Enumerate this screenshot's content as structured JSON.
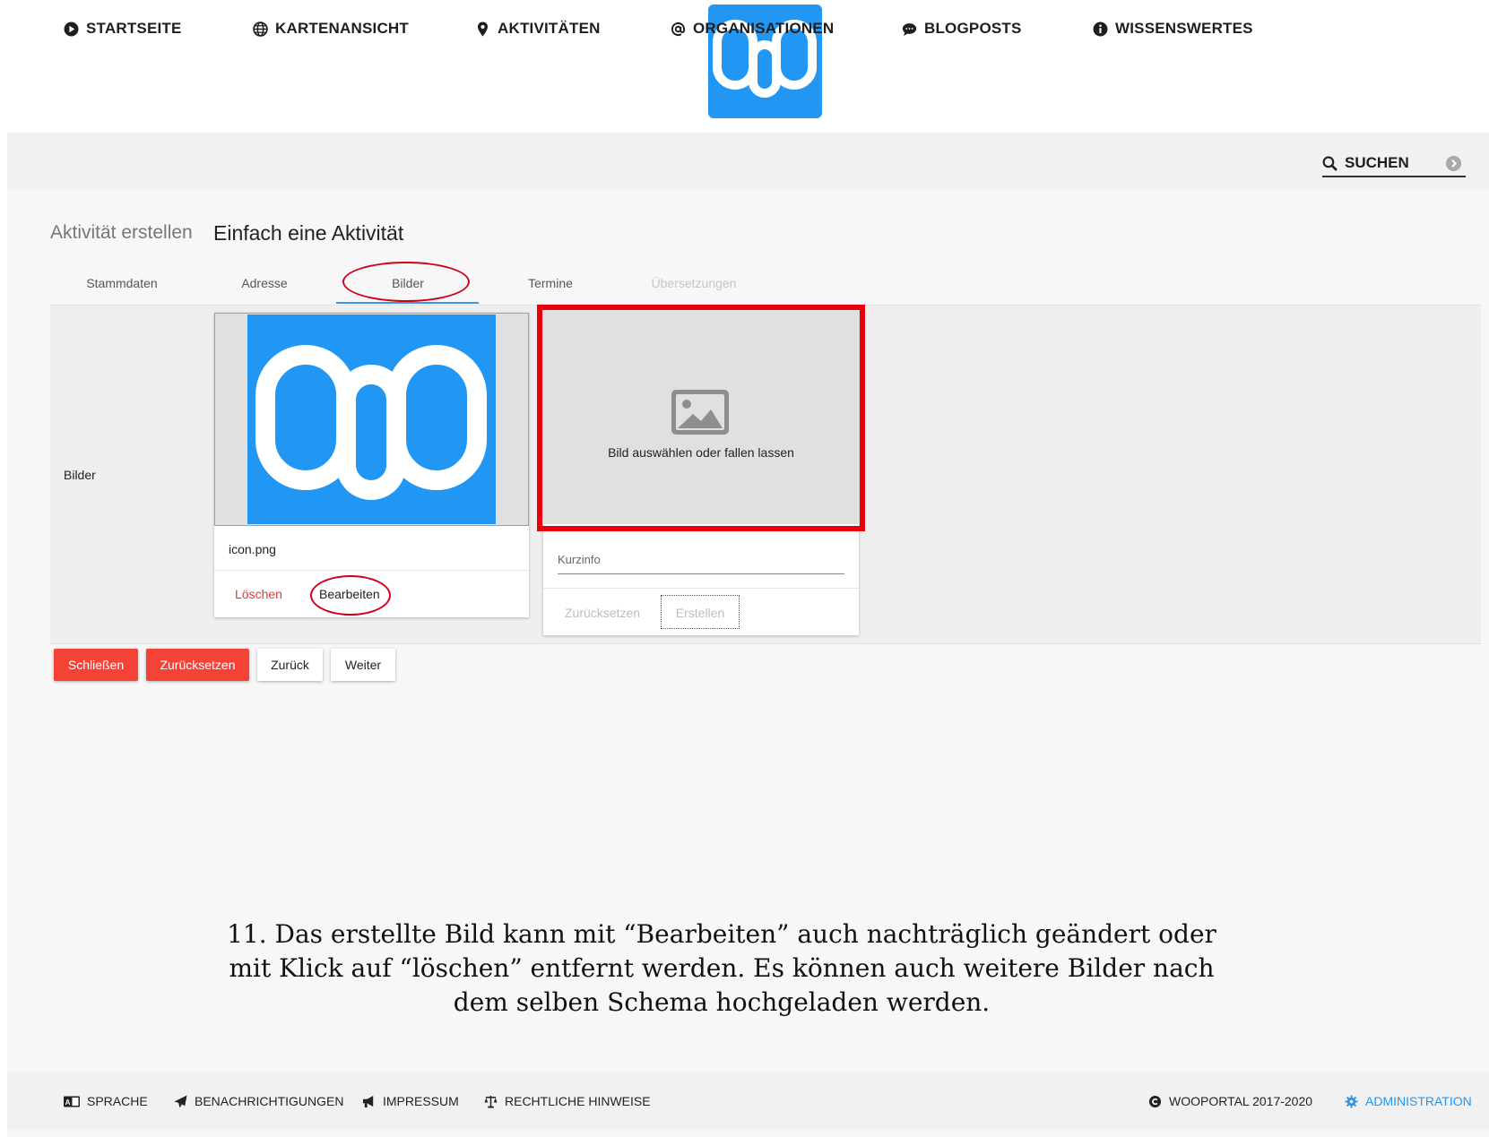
{
  "logo": {
    "name": "wooportal-logo",
    "color": "#2196f3"
  },
  "nav": {
    "items": [
      {
        "label": "STARTSEITE",
        "icon": "play-circle-icon"
      },
      {
        "label": "KARTENANSICHT",
        "icon": "globe-icon"
      },
      {
        "label": "AKTIVITÄTEN",
        "icon": "map-marker-icon"
      },
      {
        "label": "ORGANISATIONEN",
        "icon": "at-icon"
      },
      {
        "label": "BLOGPOSTS",
        "icon": "comments-icon"
      },
      {
        "label": "WISSENSWERTES",
        "icon": "info-circle-icon"
      }
    ],
    "search_label": "SUCHEN"
  },
  "page": {
    "breadcrumb": "Aktivität erstellen",
    "title": "Einfach eine Aktivität"
  },
  "tabs": [
    {
      "label": "Stammdaten",
      "active": false,
      "disabled": false
    },
    {
      "label": "Adresse",
      "active": false,
      "disabled": false
    },
    {
      "label": "Bilder",
      "active": true,
      "disabled": false
    },
    {
      "label": "Termine",
      "active": false,
      "disabled": false
    },
    {
      "label": "Übersetzungen",
      "active": false,
      "disabled": true
    }
  ],
  "images_section": {
    "label": "Bilder",
    "uploaded": {
      "file_name": "icon.png",
      "delete_label": "Löschen",
      "edit_label": "Bearbeiten"
    },
    "upload": {
      "drop_text": "Bild auswählen oder fallen lassen",
      "short_info_placeholder": "Kurzinfo",
      "reset_label": "Zurücksetzen",
      "create_label": "Erstellen"
    }
  },
  "actions": {
    "close": "Schließen",
    "reset": "Zurücksetzen",
    "back": "Zurück",
    "next": "Weiter"
  },
  "caption": {
    "line1": "11. Das erstellte Bild kann mit “Bearbeiten” auch nachträglich geändert oder",
    "line2": "mit Klick auf “löschen” entfernt werden. Es können auch weitere Bilder nach",
    "line3": "dem selben Schema hochgeladen werden."
  },
  "footer": {
    "language": "SPRACHE",
    "notifications": "BENACHRICHTIGUNGEN",
    "imprint": "IMPRESSUM",
    "legal": "RECHTLICHE HINWEISE",
    "copyright": "WOOPORTAL 2017-2020",
    "admin": "ADMINISTRATION"
  },
  "colors": {
    "accent_blue": "#2196f3",
    "tab_underline": "#3a96dd",
    "danger_red": "#f44336",
    "highlight_red": "#e8000b"
  }
}
